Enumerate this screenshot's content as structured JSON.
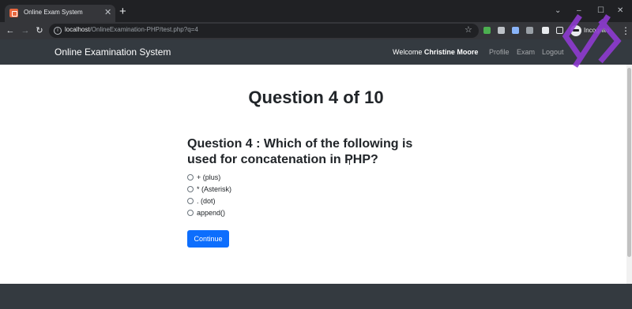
{
  "browser": {
    "tab_title": "Online Exam System",
    "tab_close": "✕",
    "new_tab": "+",
    "url_host": "localhost",
    "url_path": "/OnlineExamination-PHP/test.php?q=4",
    "incognito_label": "Incognito",
    "window_controls": {
      "minimize": "–",
      "maximize": "☐",
      "close": "✕"
    }
  },
  "navbar": {
    "brand": "Online Examination System",
    "welcome_prefix": "Welcome ",
    "user_name": "Christine Moore",
    "links": [
      "Profile",
      "Exam",
      "Logout"
    ]
  },
  "exam": {
    "heading": "Question 4 of 10",
    "question": "Question 4 : Which of the following is used for concatenation in PHP?",
    "options": [
      "+ (plus)",
      "* (Asterisk)",
      ". (dot)",
      "append()"
    ],
    "continue_label": "Continue"
  },
  "colors": {
    "navbar": "#343a40",
    "primary": "#0d6efd",
    "overlay_logo": "#8e3bd1"
  }
}
